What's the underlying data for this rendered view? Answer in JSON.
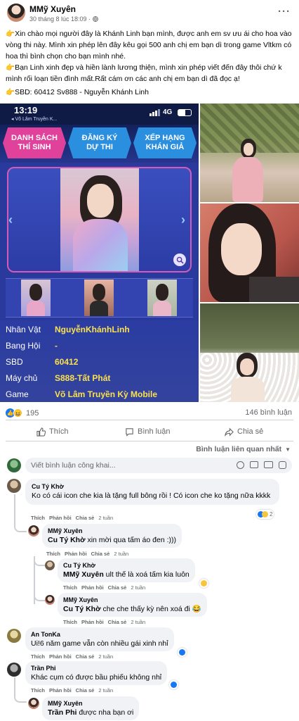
{
  "post": {
    "author": "MMỹ Xuyên",
    "date": "30 tháng 8 lúc 18:09 · ",
    "paragraphs": [
      "👉Xin chào mọi người đây là Khánh Linh bạn mình, được anh em sv ưu ái cho hoa vào vòng thi này. Mình xin phép lên đây kêu gọi 500 anh chị em bạn dì trong game Vltkm có hoa thì bình chọn cho bạn mình nhé.",
      "👉Bạn Linh xinh đẹp và hiền lành lương thiện, mình xin phép viết đến đây thôi chứ k mình rối loạn tiền đình mất.Rất cám ơn các anh chị em bạn dì đã đọc ạ!",
      "👉SBD: 60412   Sv888 -  Nguyễn Khánh Linh"
    ],
    "more_icon": "more-dots-icon",
    "privacy_icon": "globe-icon"
  },
  "phone": {
    "time": "13:19",
    "back_label": "◂ Võ Lâm Truyền K...",
    "network": "4G",
    "tabs": [
      "DANH SÁCH THÍ SINH",
      "ĐĂNG KÝ DỰ THI",
      "XẾP HẠNG KHÁN GIẢ"
    ],
    "info": [
      {
        "label": "Nhân Vật",
        "value": "NguyễnKhánhLinh"
      },
      {
        "label": "Bang Hội",
        "value": "-"
      },
      {
        "label": "SBD",
        "value": "60412"
      },
      {
        "label": "Máy chủ",
        "value": "S888-Tất Phát"
      },
      {
        "label": "Game",
        "value": "Võ Lâm Truyền Kỳ Mobile"
      }
    ]
  },
  "stats": {
    "reactions": "195",
    "comments": "146 bình luận"
  },
  "actions": {
    "like": "Thích",
    "comment": "Bình luận",
    "share": "Chia sẻ"
  },
  "sort_label": "Bình luận liên quan nhất",
  "composer": {
    "placeholder": "Viết bình luận công khai..."
  },
  "action_labels": {
    "like": "Thích",
    "reply": "Phản hồi",
    "share": "Chia sẻ"
  },
  "comments": [
    {
      "author": "Cu Tý Khờ",
      "mention": "",
      "text": "Ko có cái icon che kia là tặng full bông rồi ! Có icon che ko tặng nữa kkkk",
      "time": "2 tuần",
      "react_count": "2"
    },
    {
      "author": "MMỹ Xuyên",
      "mention": "Cu Tý Khờ",
      "text": " xin mời qua tấm áo đen :)))",
      "time": "2 tuần",
      "react_count": ""
    },
    {
      "author": "Cu Tý Khờ",
      "mention": "MMỹ Xuyên",
      "text": " ult thế là xoá tấm kia luôn",
      "time": "2 tuần",
      "react_count": ""
    },
    {
      "author": "MMỹ Xuyên",
      "mention": "Cu Tý Khờ",
      "text": " che che thấy kỳ nên xoá đi 😂",
      "time": "2 tuần",
      "react_count": ""
    },
    {
      "author": "An TonKa",
      "mention": "",
      "text": "Ui!6 năm game vẫn còn nhiều gái xinh nhỉ",
      "time": "2 tuần",
      "react_count": ""
    },
    {
      "author": "Trần Phi",
      "mention": "",
      "text": "Khác cụm có được bầu phiếu không nhỉ",
      "time": "2 tuần",
      "react_count": ""
    },
    {
      "author": "MMỹ Xuyên",
      "mention": "Trần Phi",
      "text": " được nha bạn ơi",
      "time": "",
      "react_count": ""
    }
  ],
  "colors": {
    "brand": "#1877f2",
    "phone_bg": "#2a3a9c",
    "tab_pink": "#e0419b",
    "tab_blue": "#2b8fe0",
    "gold": "#fbe14c"
  }
}
